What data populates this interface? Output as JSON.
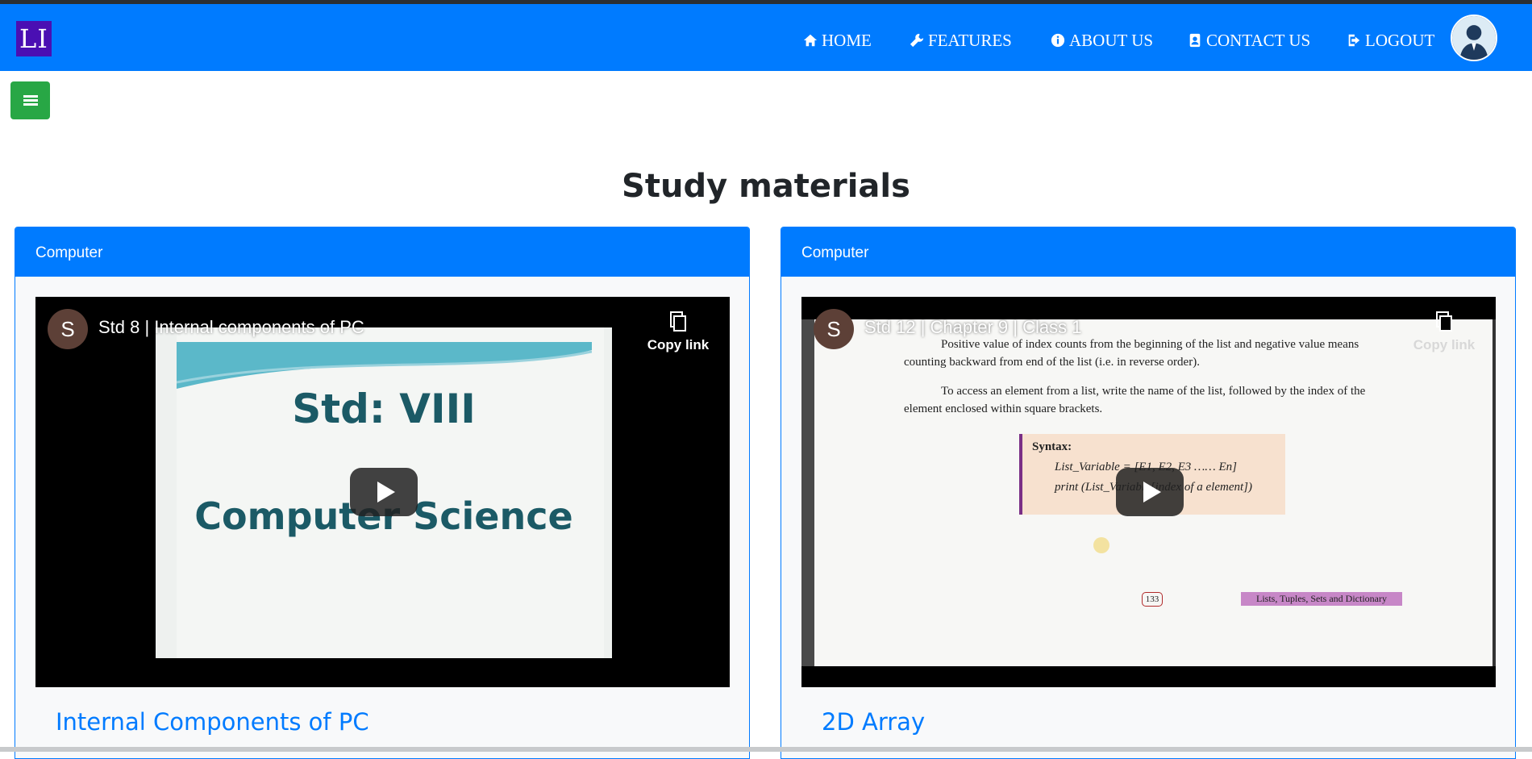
{
  "logo": {
    "text": "LI"
  },
  "nav": {
    "home": "HOME",
    "features": "FEATURES",
    "about": "ABOUT US",
    "contact": "CONTACT US",
    "logout": "LOGOUT"
  },
  "page": {
    "title": "Study materials"
  },
  "cards": [
    {
      "header": "Computer",
      "video": {
        "channel_initial": "S",
        "title": "Std 8 | Internal components of PC",
        "copy_link": "Copy link",
        "thumb_line1": "Std: VIII",
        "thumb_line2": "Computer Science"
      },
      "link": "Internal Components of PC"
    },
    {
      "header": "Computer",
      "video": {
        "channel_initial": "S",
        "title": "Std 12 | Chapter 9 | Class 1",
        "copy_link": "Copy link",
        "para1": "Positive value of index counts from the beginning of the list and negative value means counting backward from end of the list (i.e. in reverse order).",
        "para2": "To access an element from a list, write the name of the list, followed by the index of the element enclosed within square brackets.",
        "syntax_heading": "Syntax:",
        "syntax_line1": "List_Variable = [E1, E2, E3 …… En]",
        "syntax_line2": "print (List_Variable[index of a element])",
        "page_number": "133",
        "chapter_band": "Lists, Tuples, Sets and Dictionary"
      },
      "link": "2D Array"
    }
  ],
  "colors": {
    "primary": "#007bff",
    "success": "#28a745",
    "logo_bg": "#4a0fb3"
  }
}
